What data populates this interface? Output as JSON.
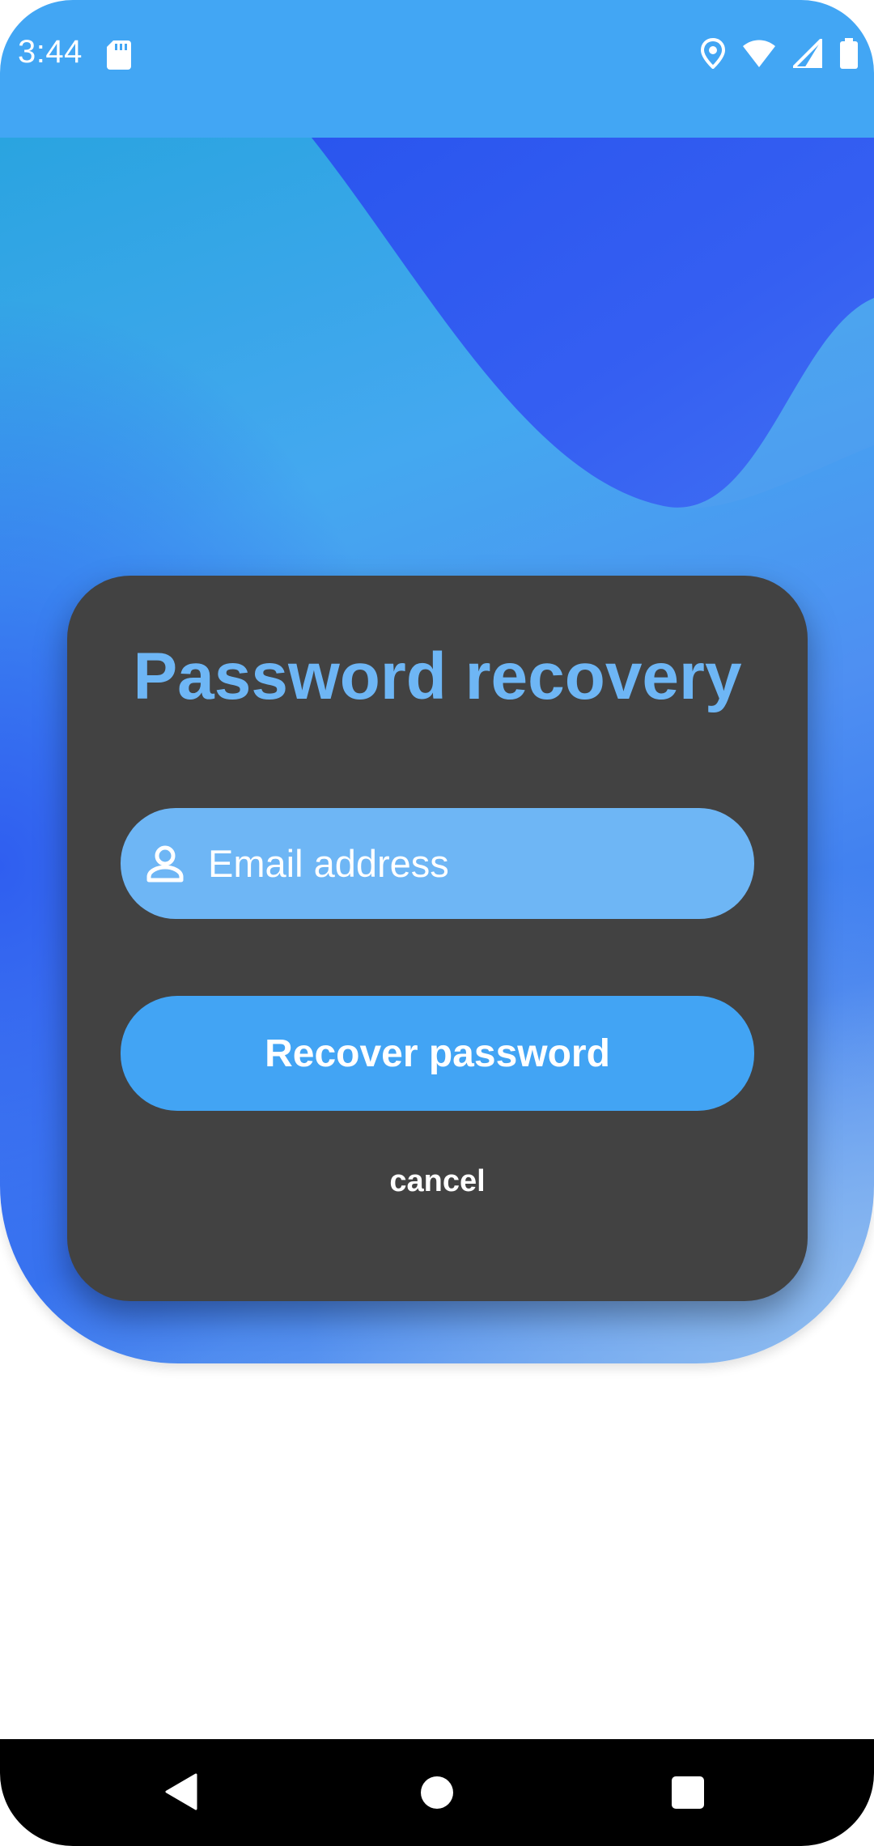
{
  "status_bar": {
    "time": "3:44",
    "left_icons": [
      "sd-card-icon"
    ],
    "right_icons": [
      "location-icon",
      "wifi-icon",
      "signal-icon",
      "battery-icon"
    ],
    "color": "#42a6f4"
  },
  "card": {
    "title": "Password recovery",
    "email_field": {
      "placeholder": "Email address",
      "value": "",
      "icon": "person-icon"
    },
    "recover_button_label": "Recover password",
    "cancel_label": "cancel"
  },
  "nav_bar": {
    "buttons": [
      "back",
      "home",
      "recents"
    ]
  },
  "colors": {
    "card_bg": "#424242",
    "title": "#6eb6f5",
    "field_bg": "#6eb6f5",
    "button_bg": "#42a4f4",
    "accent_dark": "#2f5ef0"
  }
}
